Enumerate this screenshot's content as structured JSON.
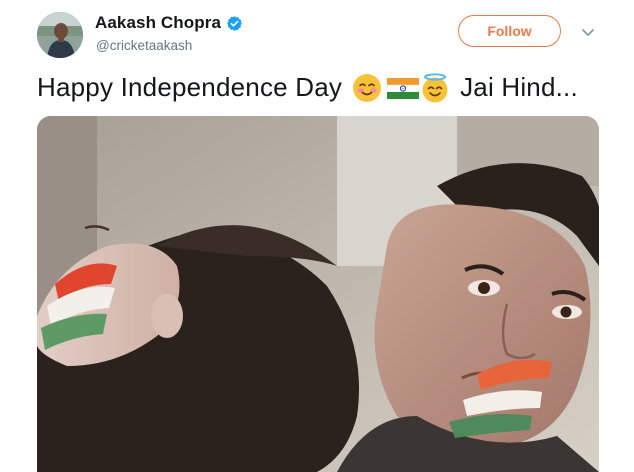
{
  "tweet": {
    "display_name": "Aakash Chopra",
    "handle": "@cricketaakash",
    "follow_label": "Follow",
    "text_before": "Happy Independence Day",
    "text_after": "Jai Hind...",
    "emojis": [
      "smiling-face-with-blush-icon",
      "india-flag-icon",
      "smiling-face-with-halo-icon"
    ]
  },
  "colors": {
    "follow_accent": "#e87a4f",
    "verified_blue": "#1da1f2",
    "name_text": "#14171a",
    "handle_text": "#657786"
  }
}
